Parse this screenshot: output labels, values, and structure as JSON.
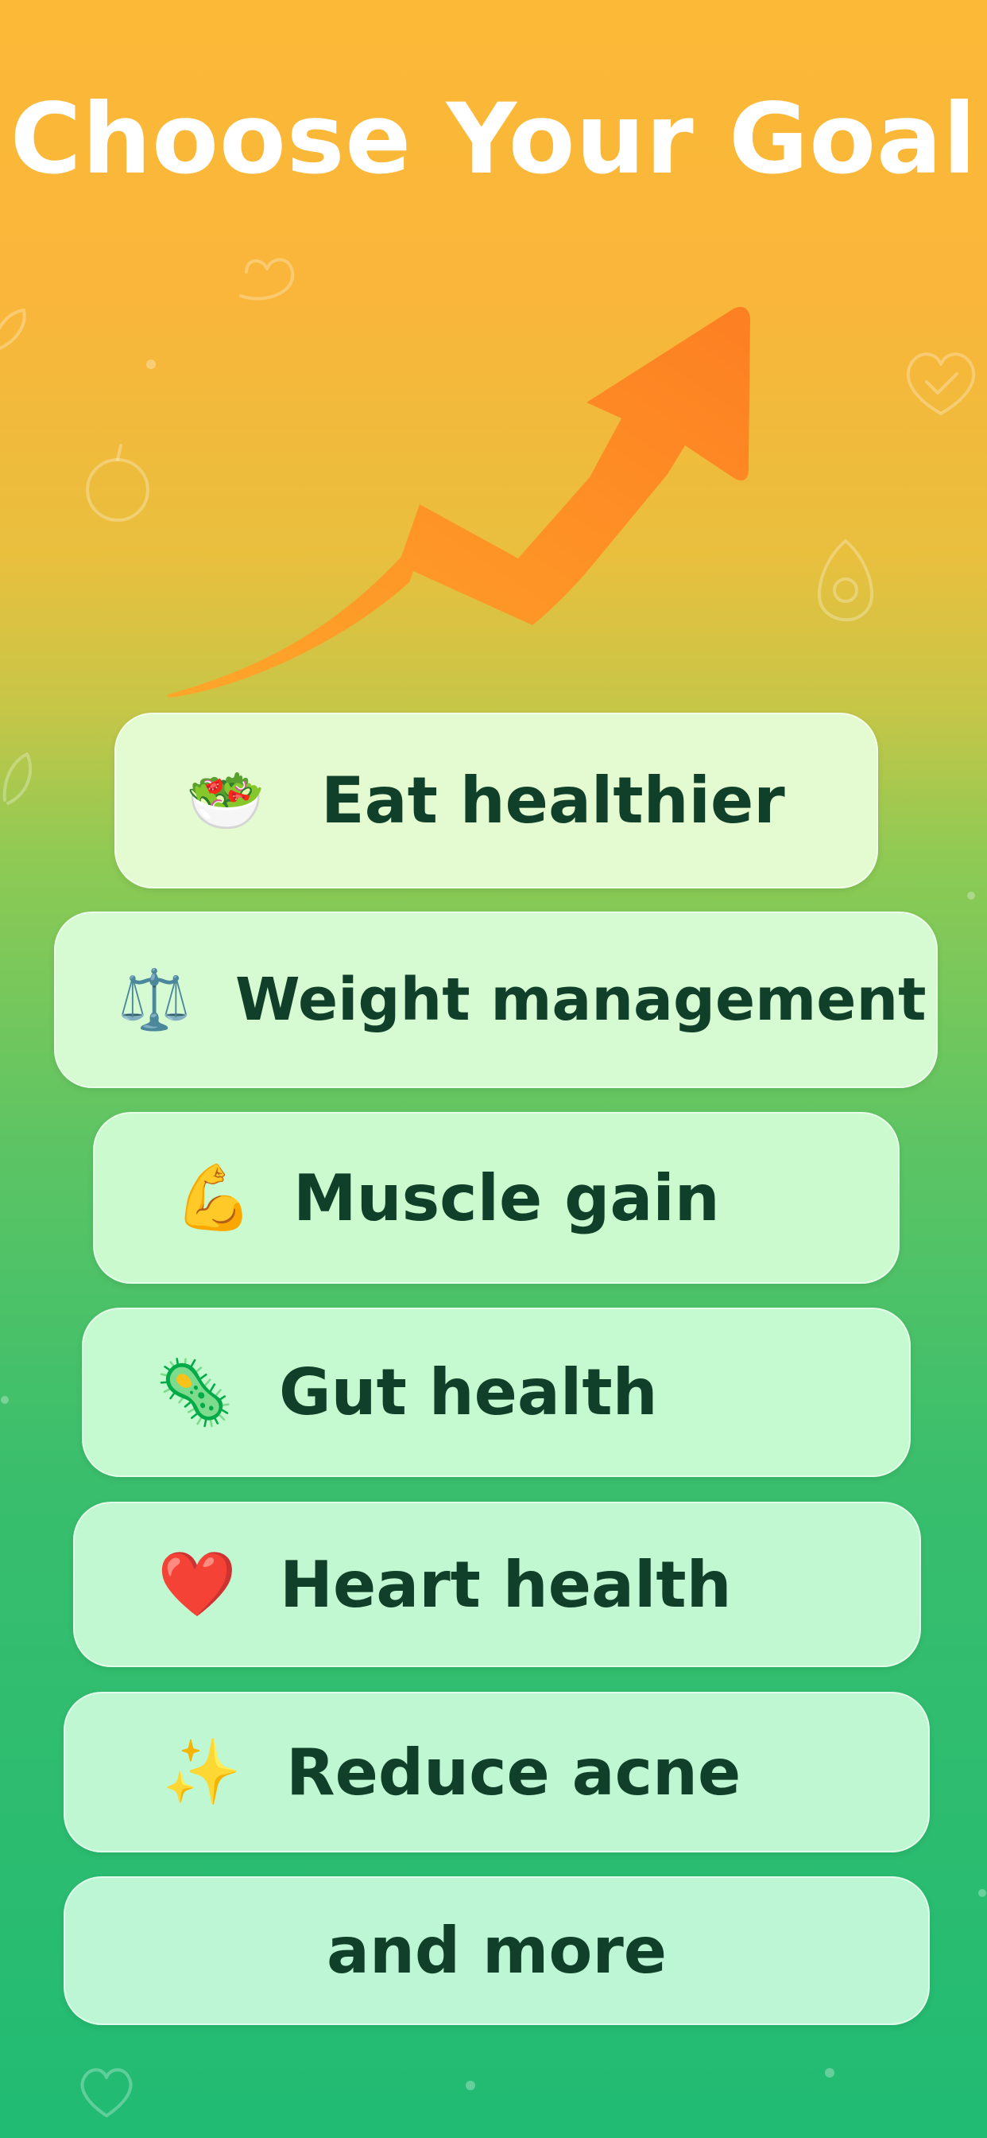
{
  "screen": {
    "title": "Choose Your Goal"
  },
  "goals": [
    {
      "emoji": "🥗",
      "icon": "salad-bowl-icon",
      "label": "Eat healthier"
    },
    {
      "emoji": "⚖️",
      "icon": "balance-scale-icon",
      "label": "Weight management"
    },
    {
      "emoji": "💪",
      "icon": "flexed-bicep-icon",
      "label": "Muscle gain"
    },
    {
      "emoji": "🦠",
      "icon": "microbe-icon",
      "label": "Gut health"
    },
    {
      "emoji": "❤️",
      "icon": "red-heart-icon",
      "label": "Heart health"
    },
    {
      "emoji": "✨",
      "icon": "sparkles-icon",
      "label": "Reduce acne"
    },
    {
      "label": "and more"
    }
  ],
  "colors": {
    "background_top": "#fcb937",
    "background_bottom": "#21bb73",
    "arrow": "#fd8a22",
    "title_text": "#ffffff",
    "button_text": "#11402a"
  }
}
